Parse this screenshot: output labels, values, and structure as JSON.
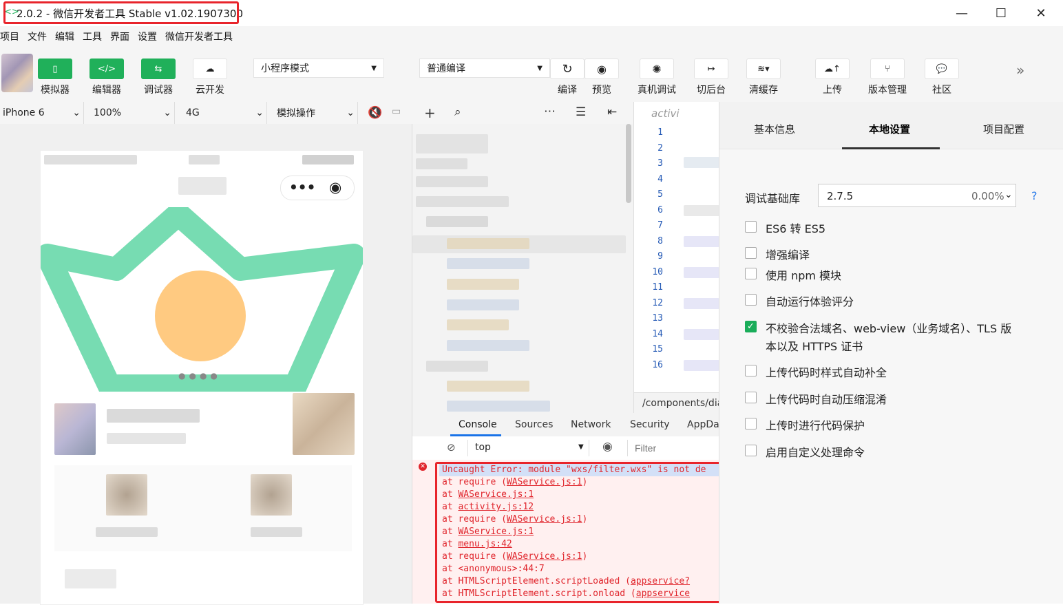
{
  "window": {
    "title": "2.0.2 - 微信开发者工具 Stable v1.02.1907300",
    "minimize": "—",
    "maximize": "☐",
    "close": "✕"
  },
  "menu": [
    "项目",
    "文件",
    "编辑",
    "工具",
    "界面",
    "设置",
    "微信开发者工具"
  ],
  "toolbar": {
    "simulator": "模拟器",
    "editor": "编辑器",
    "debugger": "调试器",
    "cloud": "云开发",
    "mode": "小程序模式",
    "compile_mode": "普通编译",
    "compile": "编译",
    "preview": "预览",
    "remote_debug": "真机调试",
    "background": "切后台",
    "clear_cache": "清缓存",
    "upload": "上传",
    "version": "版本管理",
    "community": "社区"
  },
  "simbar": {
    "device": "iPhone 6",
    "zoom": "100%",
    "network": "4G",
    "operation": "模拟操作"
  },
  "editor": {
    "tab": "activi",
    "lines": [
      "1",
      "2",
      "3",
      "4",
      "5",
      "6",
      "7",
      "8",
      "9",
      "10",
      "11",
      "12",
      "13",
      "14",
      "15",
      "16"
    ],
    "path": "/components/dia"
  },
  "devtools": {
    "tabs": [
      "Console",
      "Sources",
      "Network",
      "Security",
      "AppDa"
    ],
    "context": "top",
    "filter_placeholder": "Filter",
    "error_lines": [
      {
        "pre": "Uncaught Error: module \"wxs/filter.wxs\" is not de",
        "link": "",
        "post": ""
      },
      {
        "pre": "  at require (",
        "link": "WAService.js:1",
        "post": ")"
      },
      {
        "pre": "  at ",
        "link": "WAService.js:1",
        "post": ""
      },
      {
        "pre": "  at ",
        "link": "activity.js:12",
        "post": ""
      },
      {
        "pre": "  at require (",
        "link": "WAService.js:1",
        "post": ")"
      },
      {
        "pre": "  at ",
        "link": "WAService.js:1",
        "post": ""
      },
      {
        "pre": "  at ",
        "link": "menu.js:42",
        "post": ""
      },
      {
        "pre": "  at require (",
        "link": "WAService.js:1",
        "post": ")"
      },
      {
        "pre": "  at <anonymous>:44:7",
        "link": "",
        "post": ""
      },
      {
        "pre": "  at HTMLScriptElement.scriptLoaded (",
        "link": "appservice?",
        "post": ""
      },
      {
        "pre": "  at HTMLScriptElement.script.onload (",
        "link": "appservice",
        "post": ""
      }
    ]
  },
  "settings": {
    "tabs": [
      "基本信息",
      "本地设置",
      "项目配置"
    ],
    "active_tab": "本地设置",
    "lib_label": "调试基础库",
    "lib_version": "2.7.5",
    "lib_percent": "0.00%",
    "help": "?",
    "options": [
      {
        "label": "ES6 转 ES5",
        "checked": false
      },
      {
        "label": "增强编译",
        "checked": false
      },
      {
        "label": "使用 npm 模块",
        "checked": false
      },
      {
        "label": "自动运行体验评分",
        "checked": false
      },
      {
        "label": "不校验合法域名、web-view（业务域名）、TLS 版",
        "label2": "本以及 HTTPS 证书",
        "checked": true
      },
      {
        "label": "上传代码时样式自动补全",
        "checked": false
      },
      {
        "label": "上传代码时自动压缩混淆",
        "checked": false
      },
      {
        "label": "上传时进行代码保护",
        "checked": false
      },
      {
        "label": "启用自定义处理命令",
        "checked": false
      }
    ]
  },
  "colors": {
    "accent_green": "#20b05a",
    "error_red": "#e0242b",
    "highlight": "#e8242b"
  }
}
